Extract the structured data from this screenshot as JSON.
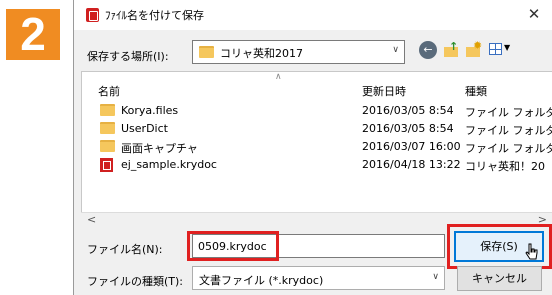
{
  "step_number": "2",
  "dialog": {
    "title": "ﾌｧｲﾙ名を付けて保存",
    "close_glyph": "✕",
    "location_label": "保存する場所(I):",
    "location_value": "コリャ英和2017",
    "icons": [
      "app-icon",
      "folder-icon",
      "back-icon",
      "up-folder-icon",
      "new-folder-icon",
      "view-menu-icon",
      "document-icon",
      "cursor-icon"
    ]
  },
  "columns": {
    "name": "名前",
    "date": "更新日時",
    "kind": "種類"
  },
  "files": [
    {
      "name": "Korya.files",
      "date": "2016/03/05 8:54",
      "kind": "ファイル フォルダー",
      "icon": "folder-icon"
    },
    {
      "name": "UserDict",
      "date": "2016/03/05 8:54",
      "kind": "ファイル フォルダー",
      "icon": "folder-icon"
    },
    {
      "name": "画面キャプチャ",
      "date": "2016/03/07 16:00",
      "kind": "ファイル フォルダー",
      "icon": "folder-icon"
    },
    {
      "name": "ej_sample.krydoc",
      "date": "2016/04/18 13:22",
      "kind": "コリャ英和！20",
      "icon": "document-icon"
    }
  ],
  "form": {
    "filename_label": "ファイル名(N):",
    "filename_value": "0509.krydoc",
    "filetype_label": "ファイルの種類(T):",
    "filetype_value": "文書ファイル (*.krydoc)",
    "save_label": "保存(S)",
    "cancel_label": "キャンセル"
  },
  "colors": {
    "step_badge": "#f08c22",
    "highlight": "#e02020",
    "focus_blue": "#0078d7"
  }
}
